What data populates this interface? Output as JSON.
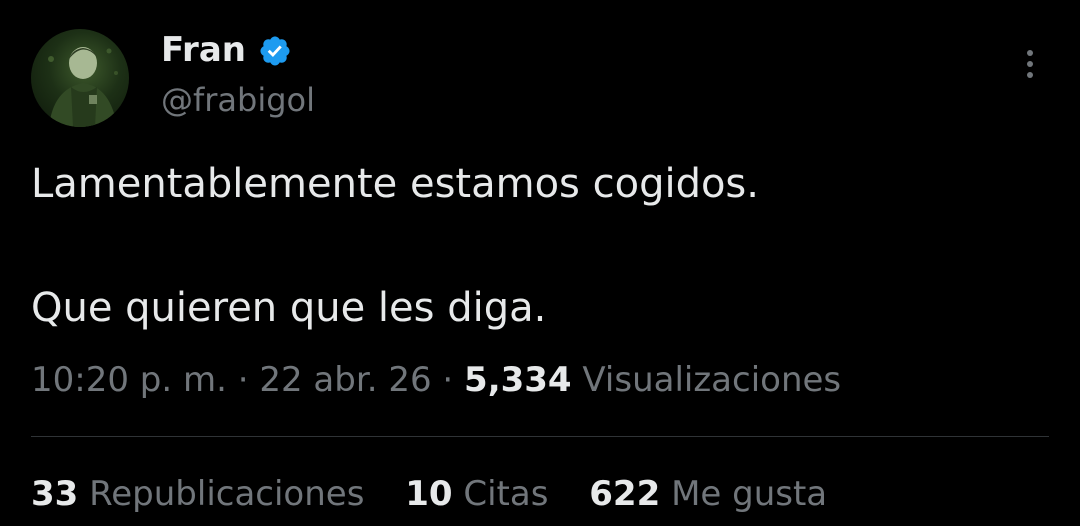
{
  "author": {
    "name": "Fran",
    "handle": "@frabigol",
    "verified_icon": "verified-badge-icon",
    "verified_color": "#1d9bf0"
  },
  "tweet": {
    "lines": [
      "Lamentablemente estamos cogidos.",
      "Que quieren que les diga."
    ]
  },
  "meta": {
    "time": "10:20 p. m.",
    "separator": "·",
    "date": "22 abr. 26",
    "views_count": "5,334",
    "views_label": "Visualizaciones"
  },
  "stats": {
    "reposts_count": "33",
    "reposts_label": "Republicaciones",
    "quotes_count": "10",
    "quotes_label": "Citas",
    "likes_count": "622",
    "likes_label": "Me gusta"
  },
  "colors": {
    "background": "#000000",
    "text_primary": "#e7e9ea",
    "text_secondary": "#71767b",
    "divider": "#2f3336"
  }
}
